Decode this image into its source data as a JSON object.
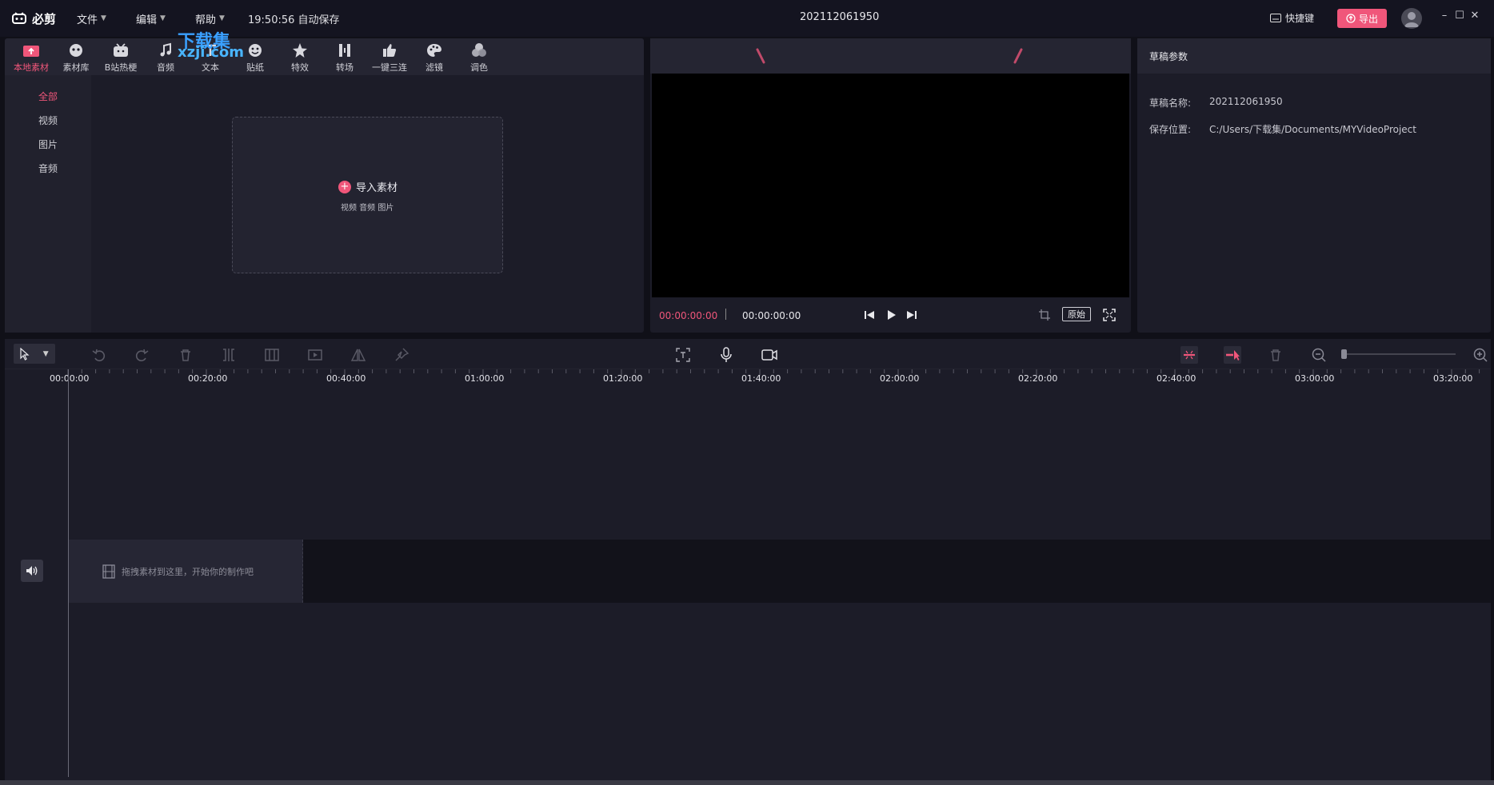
{
  "app": {
    "name": "必剪",
    "menus": [
      {
        "label": "文件"
      },
      {
        "label": "编辑"
      },
      {
        "label": "帮助"
      }
    ],
    "autosave": "19:50:56 自动保存",
    "doc_title": "202112061950",
    "shortcut_label": "快捷键",
    "export_label": "导出"
  },
  "watermark": {
    "text": "下载集",
    "url": "xzji.com"
  },
  "media_tabs": [
    {
      "label": "本地素材",
      "icon": "upload-folder-icon",
      "active": true
    },
    {
      "label": "素材库",
      "icon": "material-library-icon"
    },
    {
      "label": "B站热梗",
      "icon": "bilibili-tv-icon"
    },
    {
      "label": "音频",
      "icon": "music-note-icon"
    },
    {
      "label": "文本",
      "icon": "text-icon"
    },
    {
      "label": "贴纸",
      "icon": "sticker-icon"
    },
    {
      "label": "特效",
      "icon": "star-effect-icon"
    },
    {
      "label": "转场",
      "icon": "transition-icon"
    },
    {
      "label": "一键三连",
      "icon": "thumbs-up-icon"
    },
    {
      "label": "滤镜",
      "icon": "palette-icon"
    },
    {
      "label": "调色",
      "icon": "color-circles-icon"
    }
  ],
  "sidebar": {
    "items": [
      {
        "label": "全部",
        "active": true
      },
      {
        "label": "视频"
      },
      {
        "label": "图片"
      },
      {
        "label": "音频"
      }
    ]
  },
  "import": {
    "button_label": "导入素材",
    "subtitle": "视频 音频 图片"
  },
  "preview": {
    "current_time": "00:00:00:00",
    "total_time": "00:00:00:00",
    "original_label": "原始"
  },
  "properties": {
    "title": "草稿参数",
    "rows": [
      {
        "label": "草稿名称:",
        "value": "202112061950"
      },
      {
        "label": "保存位置:",
        "value": "C:/Users/下载集/Documents/MYVideoProject"
      }
    ]
  },
  "timeline": {
    "ticks": [
      "00:00:00",
      "00:20:00",
      "00:40:00",
      "01:00:00",
      "01:20:00",
      "01:40:00",
      "02:00:00",
      "02:20:00",
      "02:40:00",
      "03:00:00",
      "03:20:00"
    ],
    "drop_hint": "拖拽素材到这里，开始你的制作吧"
  },
  "colors": {
    "accent": "#f0567a",
    "panel": "#1c1c28",
    "background": "#101018"
  }
}
